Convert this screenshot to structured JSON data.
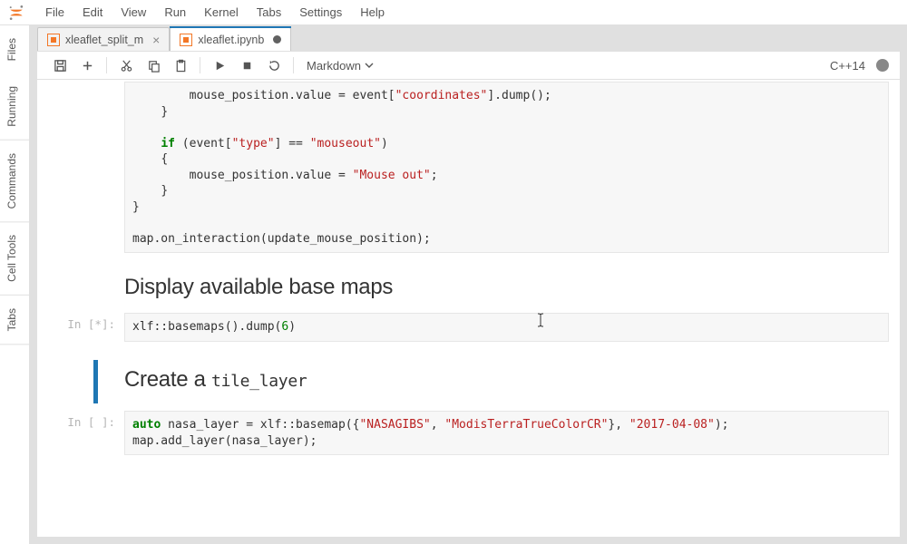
{
  "menu": {
    "items": [
      "File",
      "Edit",
      "View",
      "Run",
      "Kernel",
      "Tabs",
      "Settings",
      "Help"
    ]
  },
  "sidebar": {
    "tabs": [
      "Files",
      "Running",
      "Commands",
      "Cell Tools",
      "Tabs"
    ]
  },
  "doctabs": {
    "tabs": [
      {
        "label": "xleaflet_split_m",
        "active": false,
        "dirty": false
      },
      {
        "label": "xleaflet.ipynb",
        "active": true,
        "dirty": true
      }
    ]
  },
  "toolbar": {
    "icons": {
      "save": "save-icon",
      "add": "plus-icon",
      "cut": "scissors-icon",
      "copy": "copy-icon",
      "paste": "clipboard-icon",
      "run": "play-icon",
      "stop": "stop-icon",
      "restart": "refresh-icon"
    },
    "cell_type_label": "Markdown",
    "kernel_name": "C++14"
  },
  "cells": {
    "c0": {
      "prompt": "",
      "lines": [
        {
          "indent": 8,
          "segments": [
            {
              "t": "mouse_position.value = event["
            },
            {
              "t": "\"coordinates\"",
              "cls": "str"
            },
            {
              "t": "].dump();"
            }
          ]
        },
        {
          "indent": 4,
          "segments": [
            {
              "t": "}"
            }
          ]
        },
        {
          "indent": 0,
          "segments": [
            {
              "t": ""
            }
          ]
        },
        {
          "indent": 4,
          "segments": [
            {
              "t": "if",
              "cls": "kw"
            },
            {
              "t": " (event["
            },
            {
              "t": "\"type\"",
              "cls": "str"
            },
            {
              "t": "] == "
            },
            {
              "t": "\"mouseout\"",
              "cls": "str"
            },
            {
              "t": ")"
            }
          ]
        },
        {
          "indent": 4,
          "segments": [
            {
              "t": "{"
            }
          ]
        },
        {
          "indent": 8,
          "segments": [
            {
              "t": "mouse_position.value = "
            },
            {
              "t": "\"Mouse out\"",
              "cls": "str"
            },
            {
              "t": ";"
            }
          ]
        },
        {
          "indent": 4,
          "segments": [
            {
              "t": "}"
            }
          ]
        },
        {
          "indent": 0,
          "segments": [
            {
              "t": "}"
            }
          ]
        },
        {
          "indent": 0,
          "segments": [
            {
              "t": ""
            }
          ]
        },
        {
          "indent": 0,
          "segments": [
            {
              "t": "map.on_interaction(update_mouse_position);"
            }
          ]
        }
      ]
    },
    "h1": {
      "text_plain": "Display available base maps"
    },
    "c1": {
      "prompt": "In [*]:",
      "lines": [
        {
          "indent": 0,
          "segments": [
            {
              "t": "xlf::basemaps().dump("
            },
            {
              "t": "6",
              "cls": "num"
            },
            {
              "t": ")"
            }
          ]
        }
      ]
    },
    "h2": {
      "text_prefix": "Create a ",
      "text_mono": "tile_layer"
    },
    "c2": {
      "prompt": "In [ ]:",
      "lines": [
        {
          "indent": 0,
          "segments": [
            {
              "t": "auto",
              "cls": "kw"
            },
            {
              "t": " nasa_layer = xlf::basemap({"
            },
            {
              "t": "\"NASAGIBS\"",
              "cls": "str"
            },
            {
              "t": ", "
            },
            {
              "t": "\"ModisTerraTrueColorCR\"",
              "cls": "str"
            },
            {
              "t": "}, "
            },
            {
              "t": "\"2017-04-08\"",
              "cls": "str"
            },
            {
              "t": ");"
            }
          ]
        },
        {
          "indent": 0,
          "segments": [
            {
              "t": "map.add_layer(nasa_layer);"
            }
          ]
        }
      ]
    }
  }
}
